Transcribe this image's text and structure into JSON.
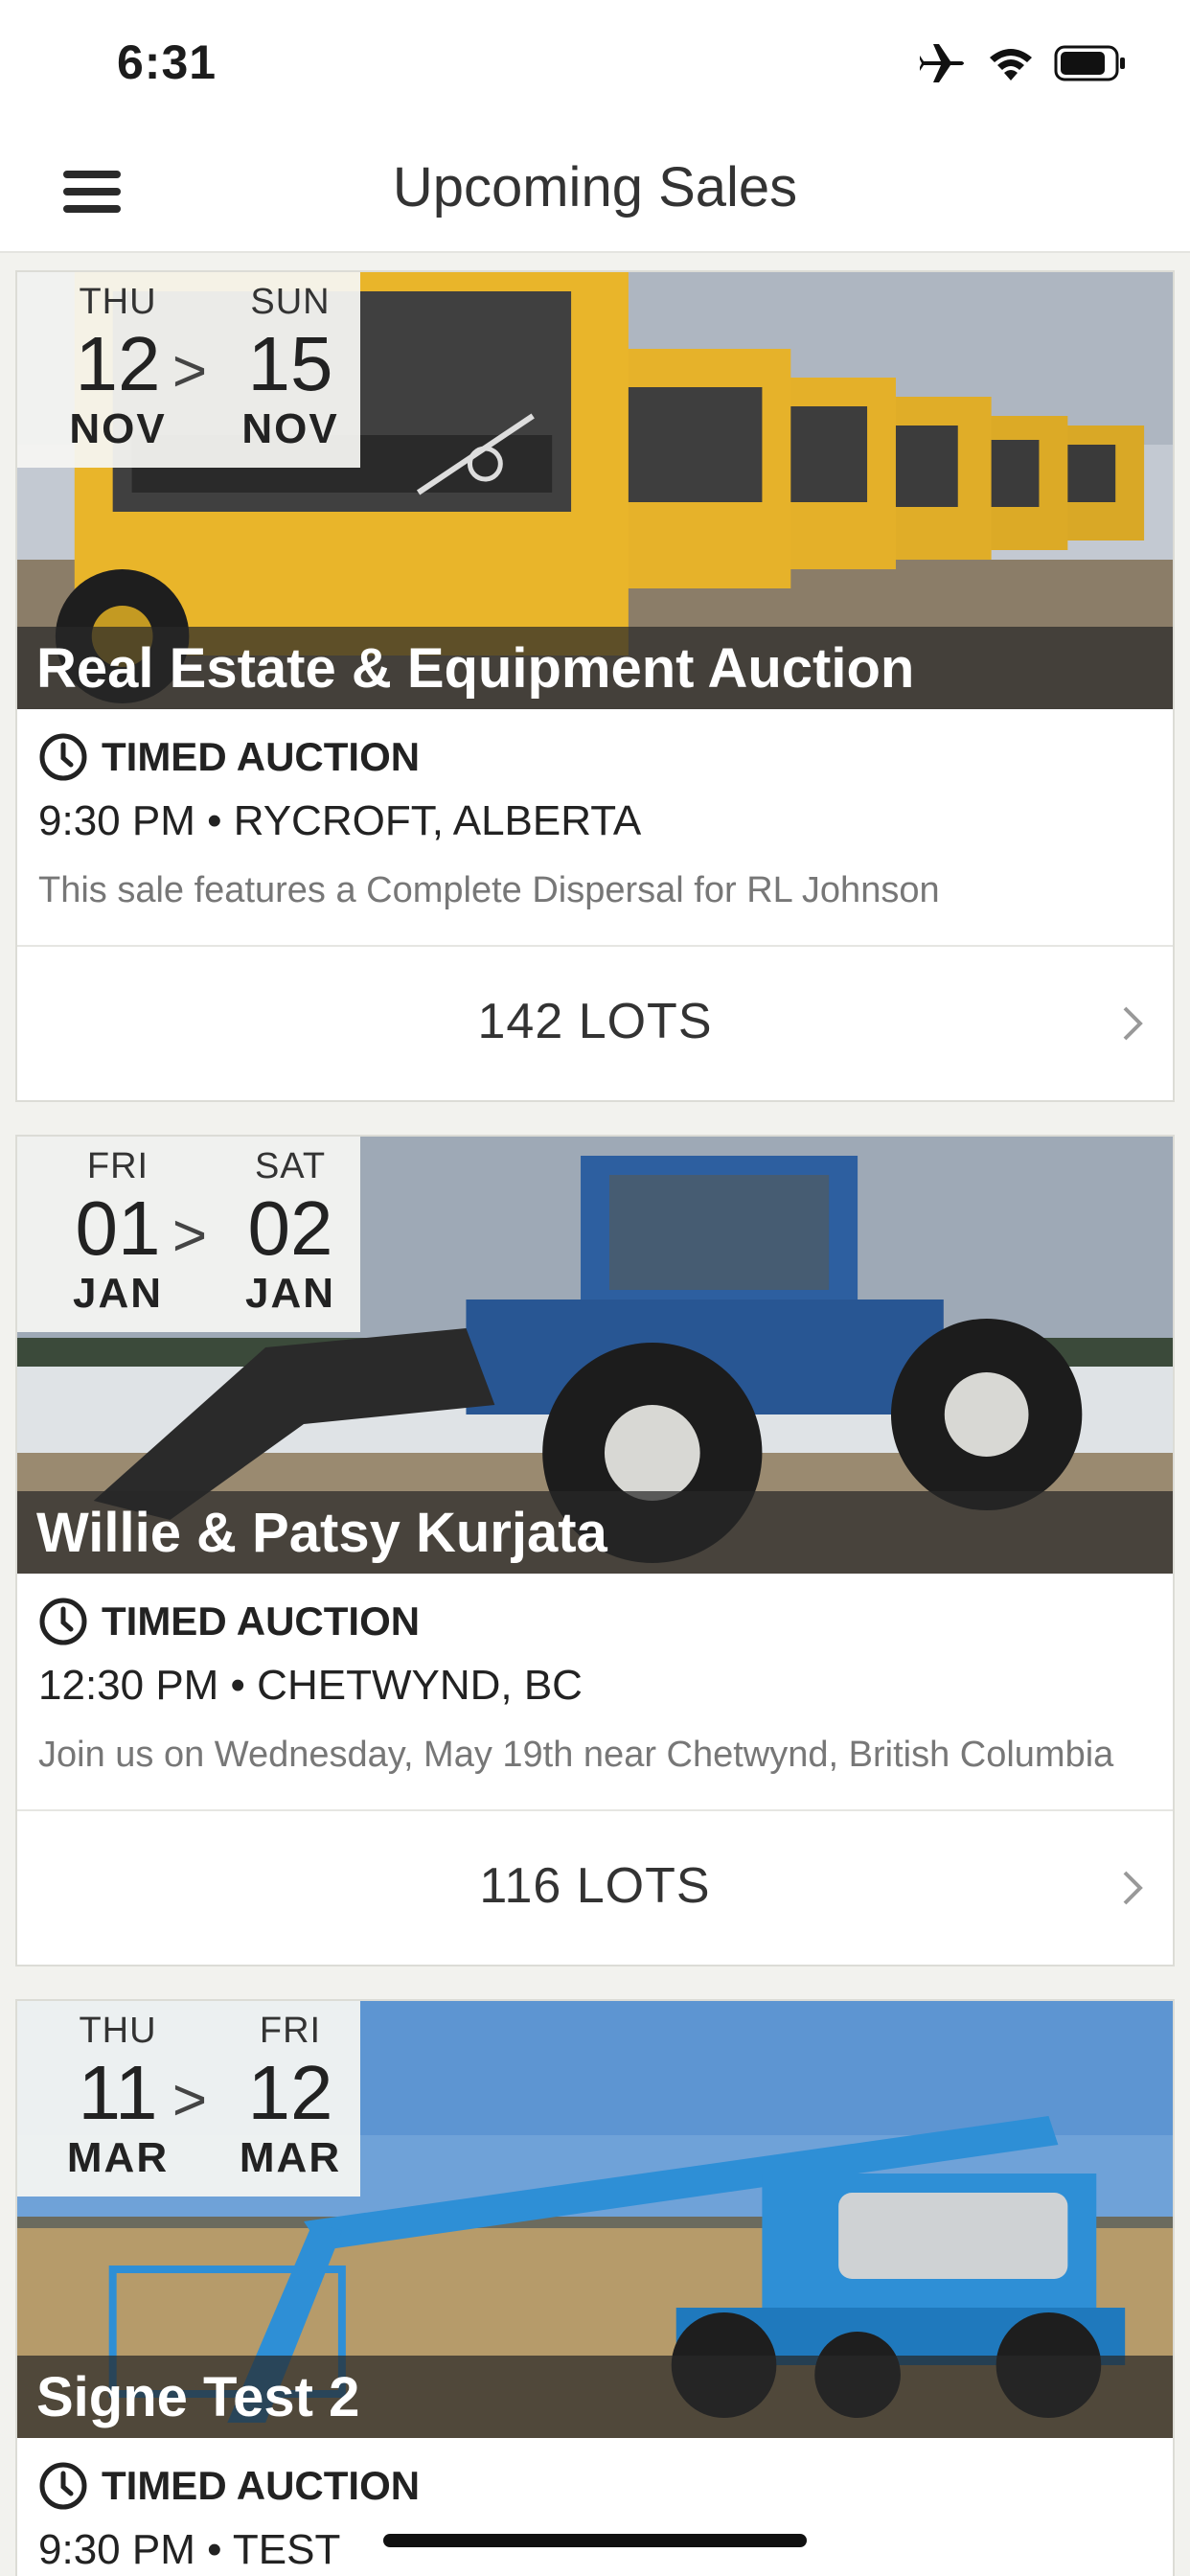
{
  "status_bar": {
    "time": "6:31"
  },
  "nav": {
    "title": "Upcoming Sales"
  },
  "sales": [
    {
      "start": {
        "dow": "THU",
        "day": "12",
        "mon": "NOV"
      },
      "arrow": ">",
      "end": {
        "dow": "SUN",
        "day": "15",
        "mon": "NOV"
      },
      "title": "Real Estate & Equipment Auction",
      "type": "TIMED AUCTION",
      "when_where": "9:30 PM • RYCROFT, ALBERTA",
      "description": "This sale features a Complete Dispersal for RL Johnson",
      "lots": "142 LOTS"
    },
    {
      "start": {
        "dow": "FRI",
        "day": "01",
        "mon": "JAN"
      },
      "arrow": ">",
      "end": {
        "dow": "SAT",
        "day": "02",
        "mon": "JAN"
      },
      "title": "Willie & Patsy Kurjata",
      "type": "TIMED AUCTION",
      "when_where": "12:30 PM • CHETWYND, BC",
      "description": "Join us on Wednesday, May 19th near Chetwynd, British Columbia",
      "lots": "116 LOTS"
    },
    {
      "start": {
        "dow": "THU",
        "day": "11",
        "mon": "MAR"
      },
      "arrow": ">",
      "end": {
        "dow": "FRI",
        "day": "12",
        "mon": "MAR"
      },
      "title": "Signe Test 2",
      "type": "TIMED AUCTION",
      "when_where": "9:30 PM • TEST",
      "description": "",
      "lots": ""
    }
  ],
  "colors": {
    "truck_yellow": "#e9b52a",
    "tractor_blue": "#2d5fa0",
    "lift_blue": "#2e8fd6",
    "title_overlay": "#282828"
  },
  "icons": [
    "hamburger-menu-icon",
    "airplane-icon",
    "wifi-icon",
    "battery-icon",
    "clock-icon",
    "chevron-right-icon"
  ]
}
